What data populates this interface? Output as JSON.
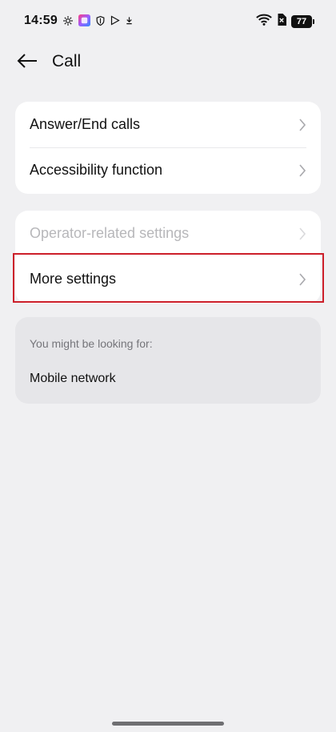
{
  "status_bar": {
    "time": "14:59",
    "battery": "77",
    "left_icons": [
      "gear-icon",
      "app-icon",
      "shield-icon",
      "play-store-icon",
      "download-icon"
    ],
    "right_icons": [
      "wifi-icon",
      "sim-off-icon",
      "battery-icon"
    ]
  },
  "header": {
    "title": "Call"
  },
  "groups": [
    {
      "items": [
        {
          "label": "Answer/End calls",
          "enabled": true
        },
        {
          "label": "Accessibility function",
          "enabled": true
        }
      ]
    },
    {
      "items": [
        {
          "label": "Operator-related settings",
          "enabled": false
        },
        {
          "label": "More settings",
          "enabled": true,
          "highlighted": true
        }
      ]
    }
  ],
  "suggestions": {
    "heading": "You might be looking for:",
    "items": [
      {
        "label": "Mobile network"
      }
    ]
  },
  "colors": {
    "background": "#f0f0f2",
    "highlight": "#cc1f2a",
    "disabled_text": "#b7b7ba"
  }
}
